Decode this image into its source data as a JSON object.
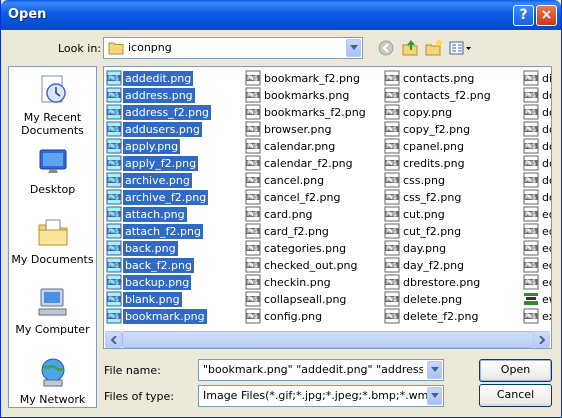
{
  "window": {
    "title": "Open",
    "help_label": "?",
    "close_label": "×"
  },
  "lookin": {
    "label": "Look in:",
    "value": "iconpng"
  },
  "places": [
    {
      "label_lines": [
        "My Recent",
        "Documents"
      ],
      "icon": "recent-documents-icon"
    },
    {
      "label_lines": [
        "Desktop"
      ],
      "icon": "desktop-icon"
    },
    {
      "label_lines": [
        "My Documents"
      ],
      "icon": "my-documents-icon"
    },
    {
      "label_lines": [
        "My Computer"
      ],
      "icon": "my-computer-icon"
    },
    {
      "label_lines": [
        "My Network"
      ],
      "icon": "my-network-icon"
    }
  ],
  "files": {
    "columns": [
      [
        {
          "name": "addedit.png",
          "selected": true
        },
        {
          "name": "address.png",
          "selected": true
        },
        {
          "name": "address_f2.png",
          "selected": true
        },
        {
          "name": "addusers.png",
          "selected": true
        },
        {
          "name": "apply.png",
          "selected": true
        },
        {
          "name": "apply_f2.png",
          "selected": true
        },
        {
          "name": "archive.png",
          "selected": true
        },
        {
          "name": "archive_f2.png",
          "selected": true
        },
        {
          "name": "attach.png",
          "selected": true
        },
        {
          "name": "attach_f2.png",
          "selected": true
        },
        {
          "name": "back.png",
          "selected": true
        },
        {
          "name": "back_f2.png",
          "selected": true
        },
        {
          "name": "backup.png",
          "selected": true
        },
        {
          "name": "blank.png",
          "selected": true
        },
        {
          "name": "bookmark.png",
          "selected": true
        }
      ],
      [
        {
          "name": "bookmark_f2.png",
          "selected": false
        },
        {
          "name": "bookmarks.png",
          "selected": false
        },
        {
          "name": "bookmarks_f2.png",
          "selected": false
        },
        {
          "name": "browser.png",
          "selected": false
        },
        {
          "name": "calendar.png",
          "selected": false
        },
        {
          "name": "calendar_f2.png",
          "selected": false
        },
        {
          "name": "cancel.png",
          "selected": false
        },
        {
          "name": "cancel_f2.png",
          "selected": false
        },
        {
          "name": "card.png",
          "selected": false
        },
        {
          "name": "card_f2.png",
          "selected": false
        },
        {
          "name": "categories.png",
          "selected": false
        },
        {
          "name": "checked_out.png",
          "selected": false
        },
        {
          "name": "checkin.png",
          "selected": false
        },
        {
          "name": "collapseall.png",
          "selected": false
        },
        {
          "name": "config.png",
          "selected": false
        }
      ],
      [
        {
          "name": "contacts.png",
          "selected": false
        },
        {
          "name": "contacts_f2.png",
          "selected": false
        },
        {
          "name": "copy.png",
          "selected": false
        },
        {
          "name": "copy_f2.png",
          "selected": false
        },
        {
          "name": "cpanel.png",
          "selected": false
        },
        {
          "name": "credits.png",
          "selected": false
        },
        {
          "name": "css.png",
          "selected": false
        },
        {
          "name": "css_f2.png",
          "selected": false
        },
        {
          "name": "cut.png",
          "selected": false
        },
        {
          "name": "cut_f2.png",
          "selected": false
        },
        {
          "name": "day.png",
          "selected": false
        },
        {
          "name": "day_f2.png",
          "selected": false
        },
        {
          "name": "dbrestore.png",
          "selected": false
        },
        {
          "name": "delete.png",
          "selected": false
        },
        {
          "name": "delete_f2.png",
          "selected": false
        }
      ],
      [
        {
          "name": "dis",
          "selected": false
        },
        {
          "name": "do",
          "selected": false
        },
        {
          "name": "do",
          "selected": false
        },
        {
          "name": "do",
          "selected": false
        },
        {
          "name": "do",
          "selected": false
        },
        {
          "name": "do",
          "selected": false
        },
        {
          "name": "do",
          "selected": false
        },
        {
          "name": "do",
          "selected": false
        },
        {
          "name": "ed",
          "selected": false
        },
        {
          "name": "ed",
          "selected": false
        },
        {
          "name": "ed",
          "selected": false
        },
        {
          "name": "ed",
          "selected": false
        },
        {
          "name": "ed",
          "selected": false
        },
        {
          "name": "ew",
          "selected": false,
          "gif": true
        },
        {
          "name": "ex",
          "selected": false
        }
      ]
    ]
  },
  "filename": {
    "label": "File name:",
    "value": "\"bookmark.png\" \"addedit.png\" \"address.png\""
  },
  "filetype": {
    "label": "Files of type:",
    "value": "Image Files(*.gif;*.jpg;*.jpeg;*.bmp;*.wmf;*.png)"
  },
  "buttons": {
    "open": "Open",
    "cancel": "Cancel"
  },
  "colors": {
    "title_bar": "#0A5DE8",
    "selection": "#316AC5",
    "dialog_bg": "#ECE9D8"
  }
}
